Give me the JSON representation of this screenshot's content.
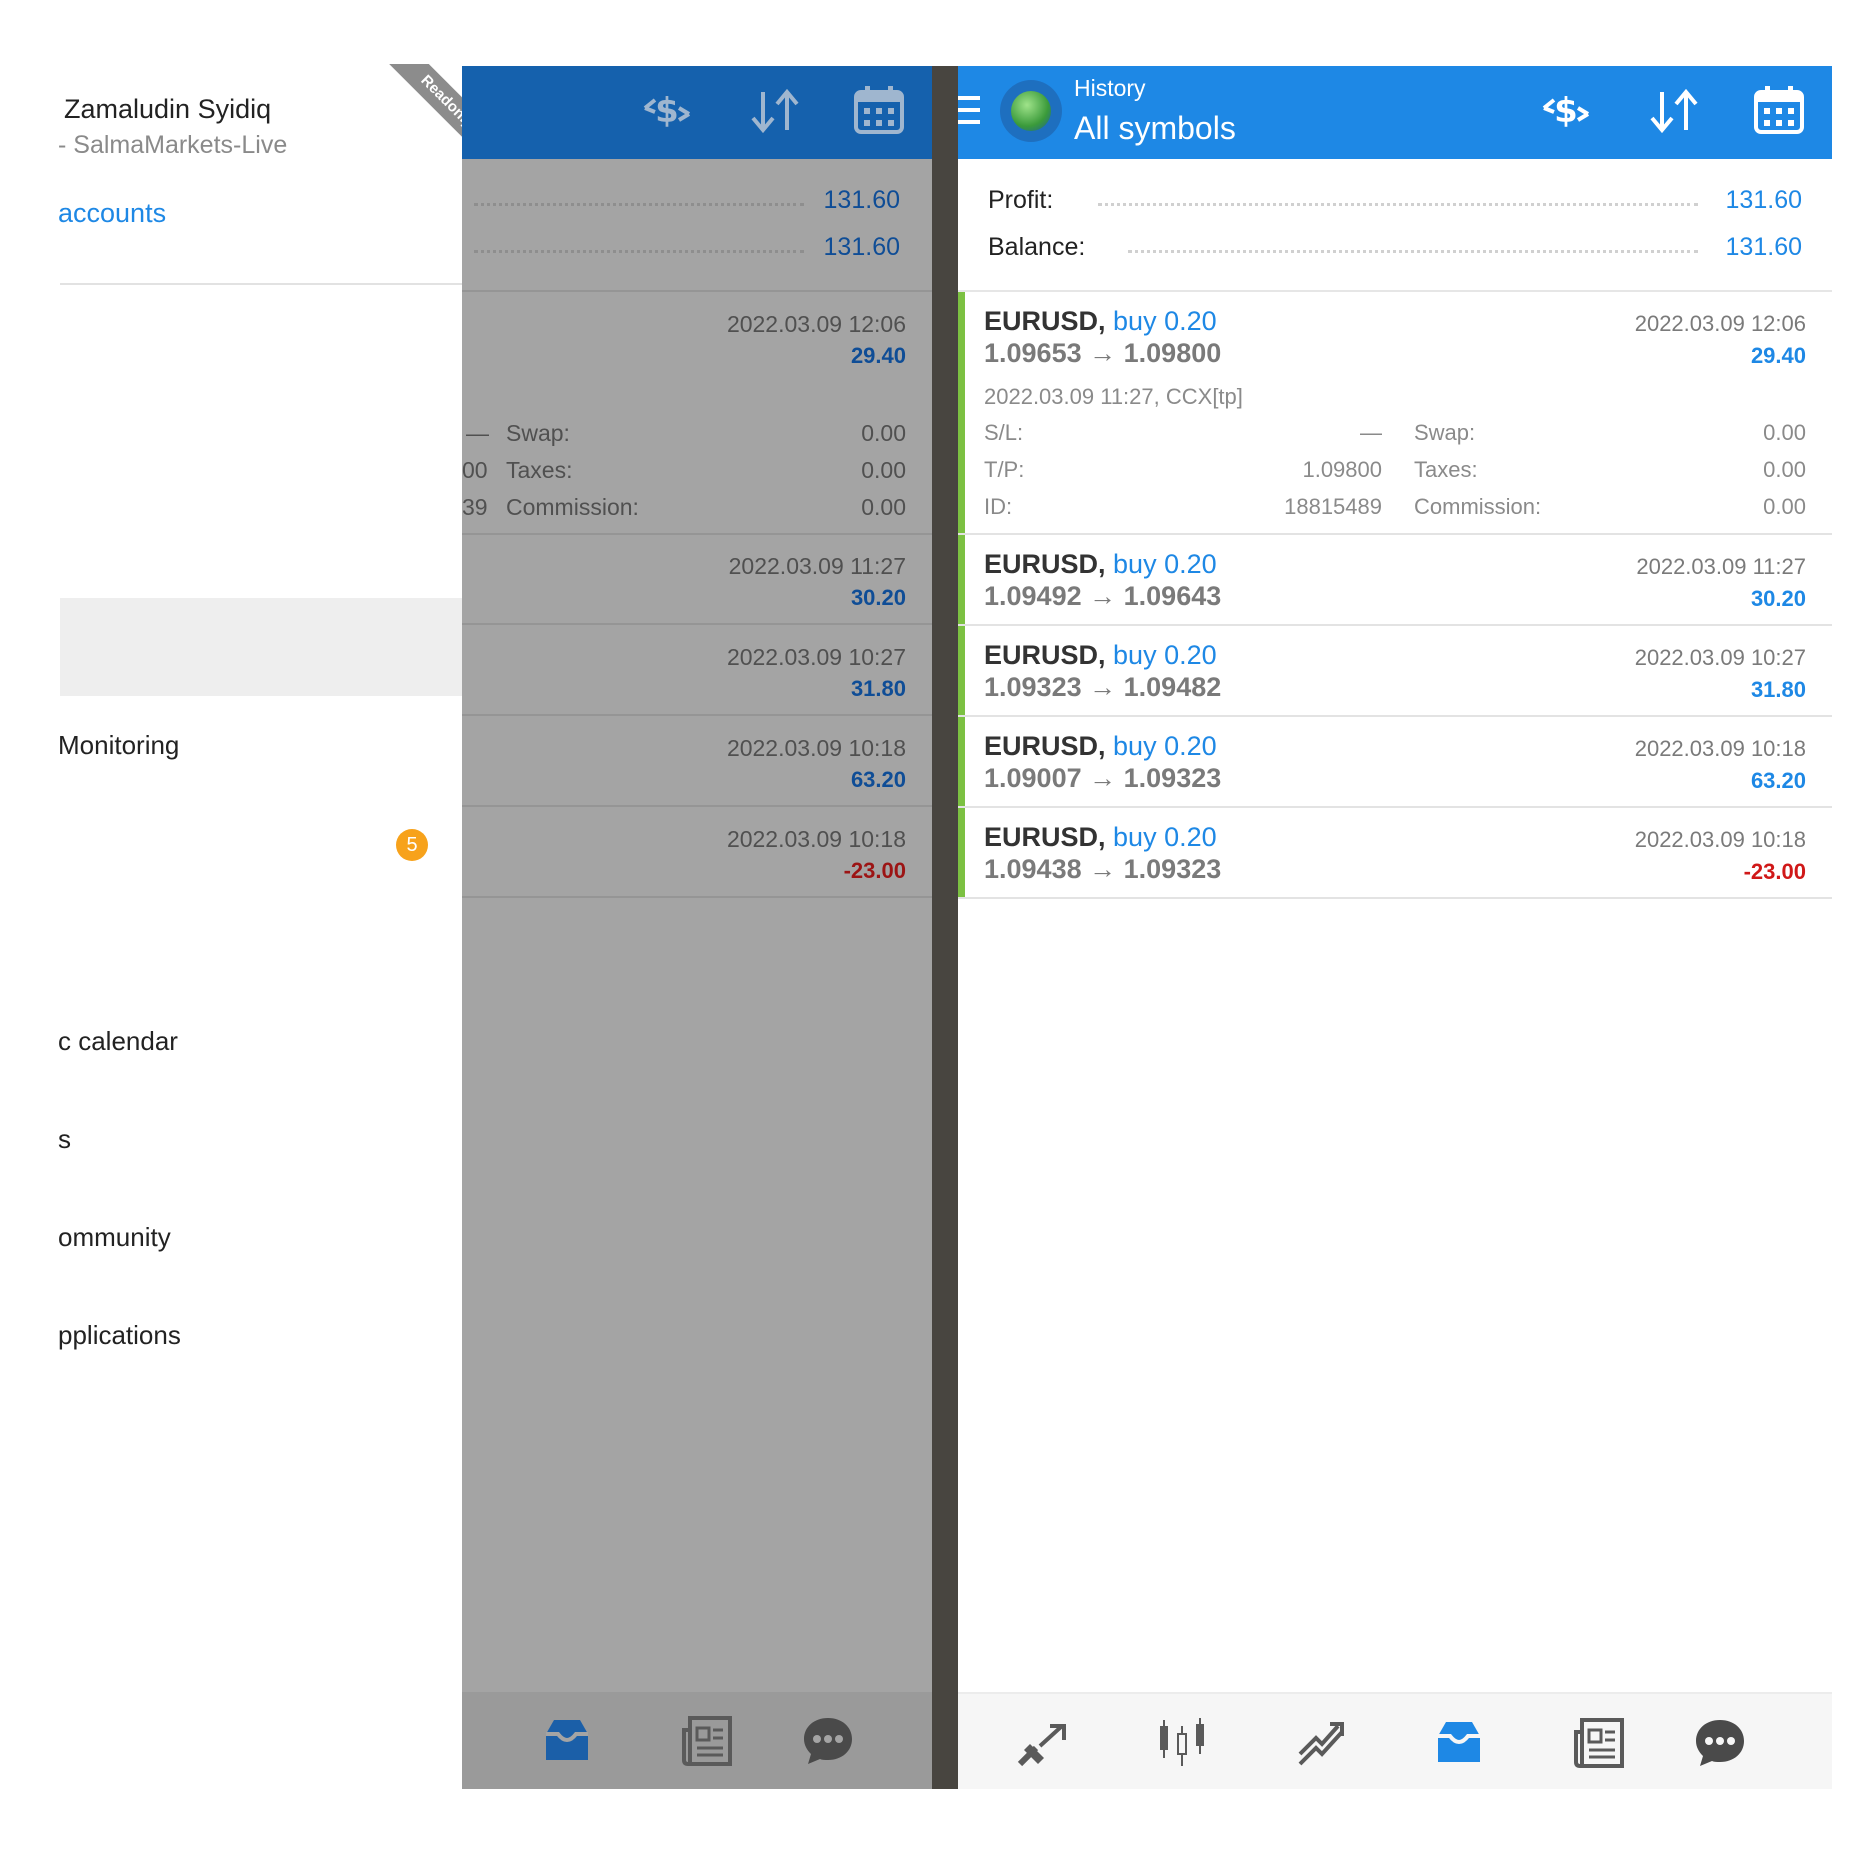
{
  "drawer": {
    "user_name": "Zamaludin Syidiq",
    "server": "- SalmaMarkets-Live",
    "accounts_link": "accounts",
    "ribbon": "Readonly",
    "menu": [
      {
        "label": "Monitoring"
      },
      {
        "label": "c calendar"
      },
      {
        "label": "s"
      },
      {
        "label": "ommunity"
      },
      {
        "label": "pplications"
      }
    ],
    "badge": "5"
  },
  "dimmed": {
    "profit": "131.60",
    "balance": "131.60",
    "deals": [
      {
        "time": "2022.03.09 12:06",
        "pnl": "29.40"
      },
      {
        "time": "2022.03.09 11:27",
        "pnl": "30.20"
      },
      {
        "time": "2022.03.09 10:27",
        "pnl": "31.80"
      },
      {
        "time": "2022.03.09 10:18",
        "pnl": "63.20"
      },
      {
        "time": "2022.03.09 10:18",
        "pnl": "-23.00"
      }
    ],
    "detail": {
      "sl_partial": "—",
      "tp_partial": "00",
      "id_partial": "39",
      "swap_label": "Swap:",
      "swap": "0.00",
      "taxes_label": "Taxes:",
      "taxes": "0.00",
      "commission_label": "Commission:",
      "commission": "0.00"
    }
  },
  "app": {
    "header": {
      "subtitle": "History",
      "title": "All symbols"
    },
    "summary": {
      "profit_label": "Profit:",
      "profit": "131.60",
      "balance_label": "Balance:",
      "balance": "131.60"
    },
    "deals": [
      {
        "symbol": "EURUSD,",
        "side": "buy 0.20",
        "open": "1.09653",
        "close": "1.09800",
        "time": "2022.03.09 12:06",
        "pnl": "29.40",
        "positive": true
      },
      {
        "symbol": "EURUSD,",
        "side": "buy 0.20",
        "open": "1.09492",
        "close": "1.09643",
        "time": "2022.03.09 11:27",
        "pnl": "30.20",
        "positive": true
      },
      {
        "symbol": "EURUSD,",
        "side": "buy 0.20",
        "open": "1.09323",
        "close": "1.09482",
        "time": "2022.03.09 10:27",
        "pnl": "31.80",
        "positive": true
      },
      {
        "symbol": "EURUSD,",
        "side": "buy 0.20",
        "open": "1.09007",
        "close": "1.09323",
        "time": "2022.03.09 10:18",
        "pnl": "63.20",
        "positive": true
      },
      {
        "symbol": "EURUSD,",
        "side": "buy 0.20",
        "open": "1.09438",
        "close": "1.09323",
        "time": "2022.03.09 10:18",
        "pnl": "-23.00",
        "positive": false
      }
    ],
    "detail": {
      "open_info": "2022.03.09 11:27, CCX[tp]",
      "sl_label": "S/L:",
      "sl": "—",
      "tp_label": "T/P:",
      "tp": "1.09800",
      "id_label": "ID:",
      "id": "18815489",
      "swap_label": "Swap:",
      "swap": "0.00",
      "taxes_label": "Taxes:",
      "taxes": "0.00",
      "commission_label": "Commission:",
      "commission": "0.00"
    },
    "arrow": "→"
  },
  "colors": {
    "primary": "#1e88e5",
    "negative": "#d01818",
    "profit_bar": "#7cc142",
    "badge": "#f7a21b"
  },
  "icons": [
    "menu-icon",
    "metatrader-logo-icon",
    "currency-exchange-icon",
    "sort-icon",
    "calendar-icon",
    "quotes-icon",
    "chart-icon",
    "trade-icon",
    "history-icon",
    "news-icon",
    "chat-icon"
  ]
}
